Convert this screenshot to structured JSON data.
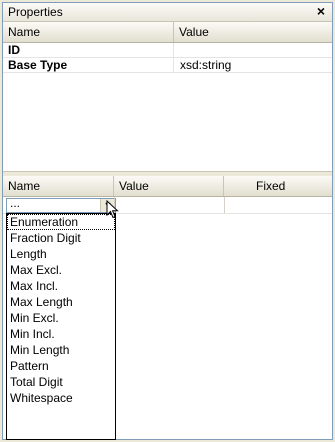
{
  "panel": {
    "title": "Properties",
    "close_glyph": "×"
  },
  "grid": {
    "columns": [
      "Name",
      "Value"
    ],
    "rows": [
      {
        "name": "ID",
        "value": ""
      },
      {
        "name": "Base Type",
        "value": "xsd:string"
      }
    ]
  },
  "facets": {
    "columns": [
      "Name",
      "Value",
      "Fixed"
    ],
    "edit_row": {
      "name_value": "...",
      "dropdown_arrow": "▼"
    },
    "dropdown_options": [
      "Enumeration",
      "Fraction Digit",
      "Length",
      "Max Excl.",
      "Max Incl.",
      "Max Length",
      "Min Excl.",
      "Min Incl.",
      "Min Length",
      "Pattern",
      "Total Digit",
      "Whitespace"
    ],
    "highlighted_index": 0
  }
}
